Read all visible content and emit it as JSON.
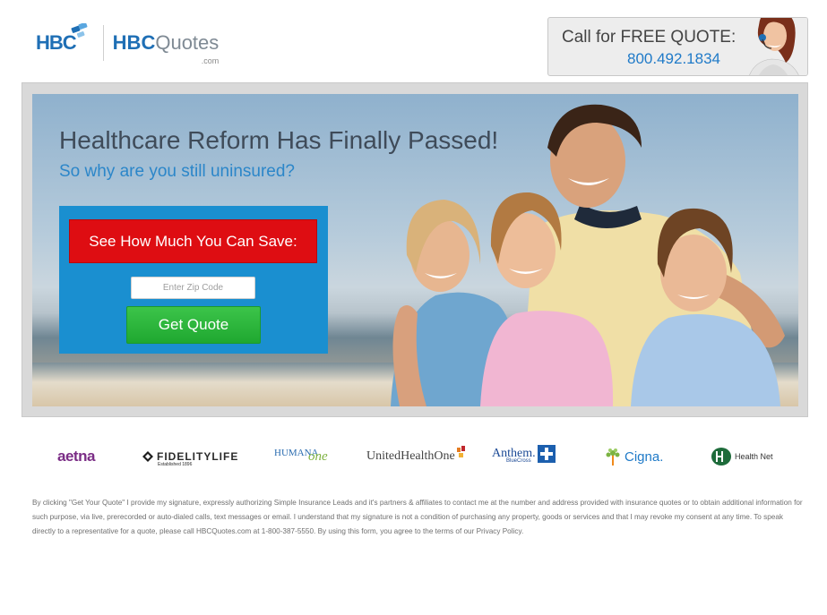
{
  "header": {
    "logo_hbc": "HBC",
    "logo_quotes_bold": "HBC",
    "logo_quotes_light": "Quotes",
    "logo_dotcom": ".com",
    "call_title": "Call for FREE QUOTE:",
    "call_phone": "800.492.1834"
  },
  "hero": {
    "headline": "Healthcare Reform Has Finally Passed!",
    "subhead": "So why are you still uninsured?",
    "form": {
      "banner": "See How Much You Can Save:",
      "zip_placeholder": "Enter Zip Code",
      "zip_value": "",
      "button": "Get Quote"
    }
  },
  "partners": {
    "aetna": "aetna",
    "fidelity": "FIDELITYLIFE",
    "fidelity_sub": "Established 1896",
    "humana": "HUMANA",
    "humana_one": "one",
    "uho": "UnitedHealthOne",
    "anthem": "Anthem.",
    "anthem_sub": "BlueCross",
    "cigna": "Cigna.",
    "healthnet": "Health Net"
  },
  "disclaimer": "By clicking \"Get Your Quote\" I provide my signature, expressly authorizing Simple Insurance Leads and it's partners & affiliates to contact me at the number and address provided with insurance quotes or to obtain additional information for such purpose, via live, prerecorded or auto-dialed calls, text messages or email. I understand that my signature is not a condition of purchasing any property, goods or services and that I may revoke my consent at any time. To speak directly to a representative for a quote, please call HBCQuotes.com at 1-800-387-5550. By using this form, you agree to the terms of our Privacy Policy.",
  "colors": {
    "brand_blue": "#1f6fb5",
    "form_blue": "#1a8fd0",
    "banner_red": "#de0d12",
    "button_green": "#2bb73c"
  }
}
